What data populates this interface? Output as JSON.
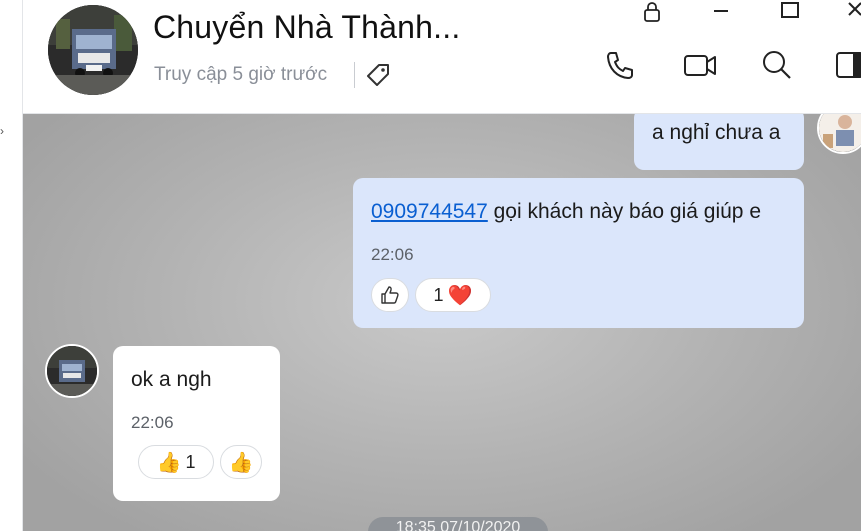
{
  "header": {
    "title": "Chuyển Nhà Thành...",
    "status": "Truy cập 5 giờ trước"
  },
  "icons": {
    "lock": "lock-icon",
    "minimize": "minimize-icon",
    "maximize": "maximize-icon",
    "close": "close-icon",
    "call": "phone-icon",
    "video": "video-icon",
    "search": "search-icon",
    "panel": "sidebar-toggle-icon",
    "tag": "tag-icon"
  },
  "messages": [
    {
      "from": "me",
      "text": "a nghỉ chưa a"
    },
    {
      "from": "me",
      "link": "0909744547",
      "text": " gọi khách này báo giá giúp e",
      "time": "22:06",
      "reactions": {
        "like_icon": "thumbs-up-outline-icon",
        "count": "1",
        "emoji": "❤️"
      }
    },
    {
      "from": "them",
      "text": "ok a ngh",
      "time": "22:06",
      "reactions": {
        "emoji": "👍",
        "count": "1",
        "like_emoji": "👍"
      }
    }
  ],
  "date_separator": "18:35 07/10/2020",
  "colors": {
    "my_bubble": "#dbe6fb",
    "their_bubble": "#ffffff",
    "link": "#0a5fd1"
  }
}
